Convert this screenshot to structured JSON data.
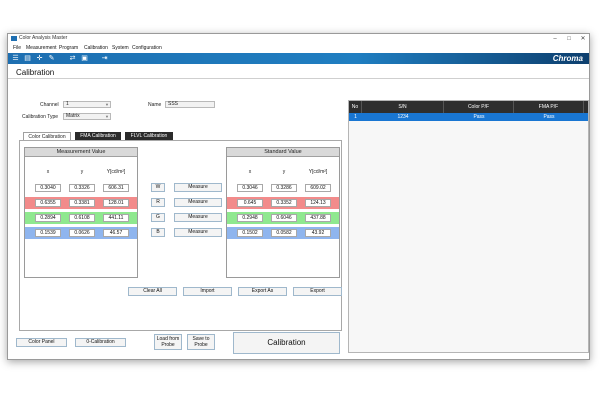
{
  "window": {
    "title": "Color Analysis Master",
    "minimize": "–",
    "maximize": "□",
    "close": "✕"
  },
  "menu": [
    "File",
    "Measurement",
    "Program",
    "Calibration",
    "System",
    "Configuration"
  ],
  "brand": "Chroma",
  "page_title": "Calibration",
  "form": {
    "channel_label": "Channel",
    "channel_value": "1",
    "calib_type_label": "Calibration Type",
    "calib_type_value": "Matrix",
    "name_label": "Name",
    "name_value": "SSS"
  },
  "tabs": [
    "Color Calibration",
    "FMA Calibration",
    "FLVL Calibration"
  ],
  "measurement": {
    "title": "Measurement Value",
    "headers": [
      "x",
      "y",
      "Y[cd/m²]"
    ],
    "rows": [
      [
        "0.3040",
        "0.3326",
        "606.31"
      ],
      [
        "0.6355",
        "0.3381",
        "128.01"
      ],
      [
        "0.2894",
        "0.6108",
        "441.11"
      ],
      [
        "0.1539",
        "0.0626",
        "46.57"
      ]
    ]
  },
  "standard": {
    "title": "Standard Value",
    "headers": [
      "x",
      "y",
      "Y[cd/m²]"
    ],
    "rows": [
      [
        "0.3046",
        "0.3286",
        "609.02"
      ],
      [
        "0.645",
        "0.3352",
        "124.13"
      ],
      [
        "0.2948",
        "0.6046",
        "437.88"
      ],
      [
        "0.1502",
        "0.0582",
        "43.92"
      ]
    ]
  },
  "row_colors": [
    "#ffffff",
    "#f28b8b",
    "#8fe88f",
    "#8fb5ee"
  ],
  "channels": [
    "W",
    "R",
    "G",
    "B"
  ],
  "measure_label": "Measure",
  "actions": [
    "Clear All",
    "Import",
    "Export As",
    "Export"
  ],
  "bottom": {
    "color_panel": "Color Panel",
    "zero_calibration": "0-Calibration",
    "load_from_probe": "Load from\nProbe",
    "save_to_probe": "Save to\nProbe",
    "calibration": "Calibration"
  },
  "grid": {
    "headers": [
      "No",
      "S/N",
      "Color P/F",
      "FMA P/F"
    ],
    "rows": [
      [
        "1",
        "1234",
        "Pass",
        "Pass"
      ]
    ],
    "selected_color": "#1976d2"
  }
}
